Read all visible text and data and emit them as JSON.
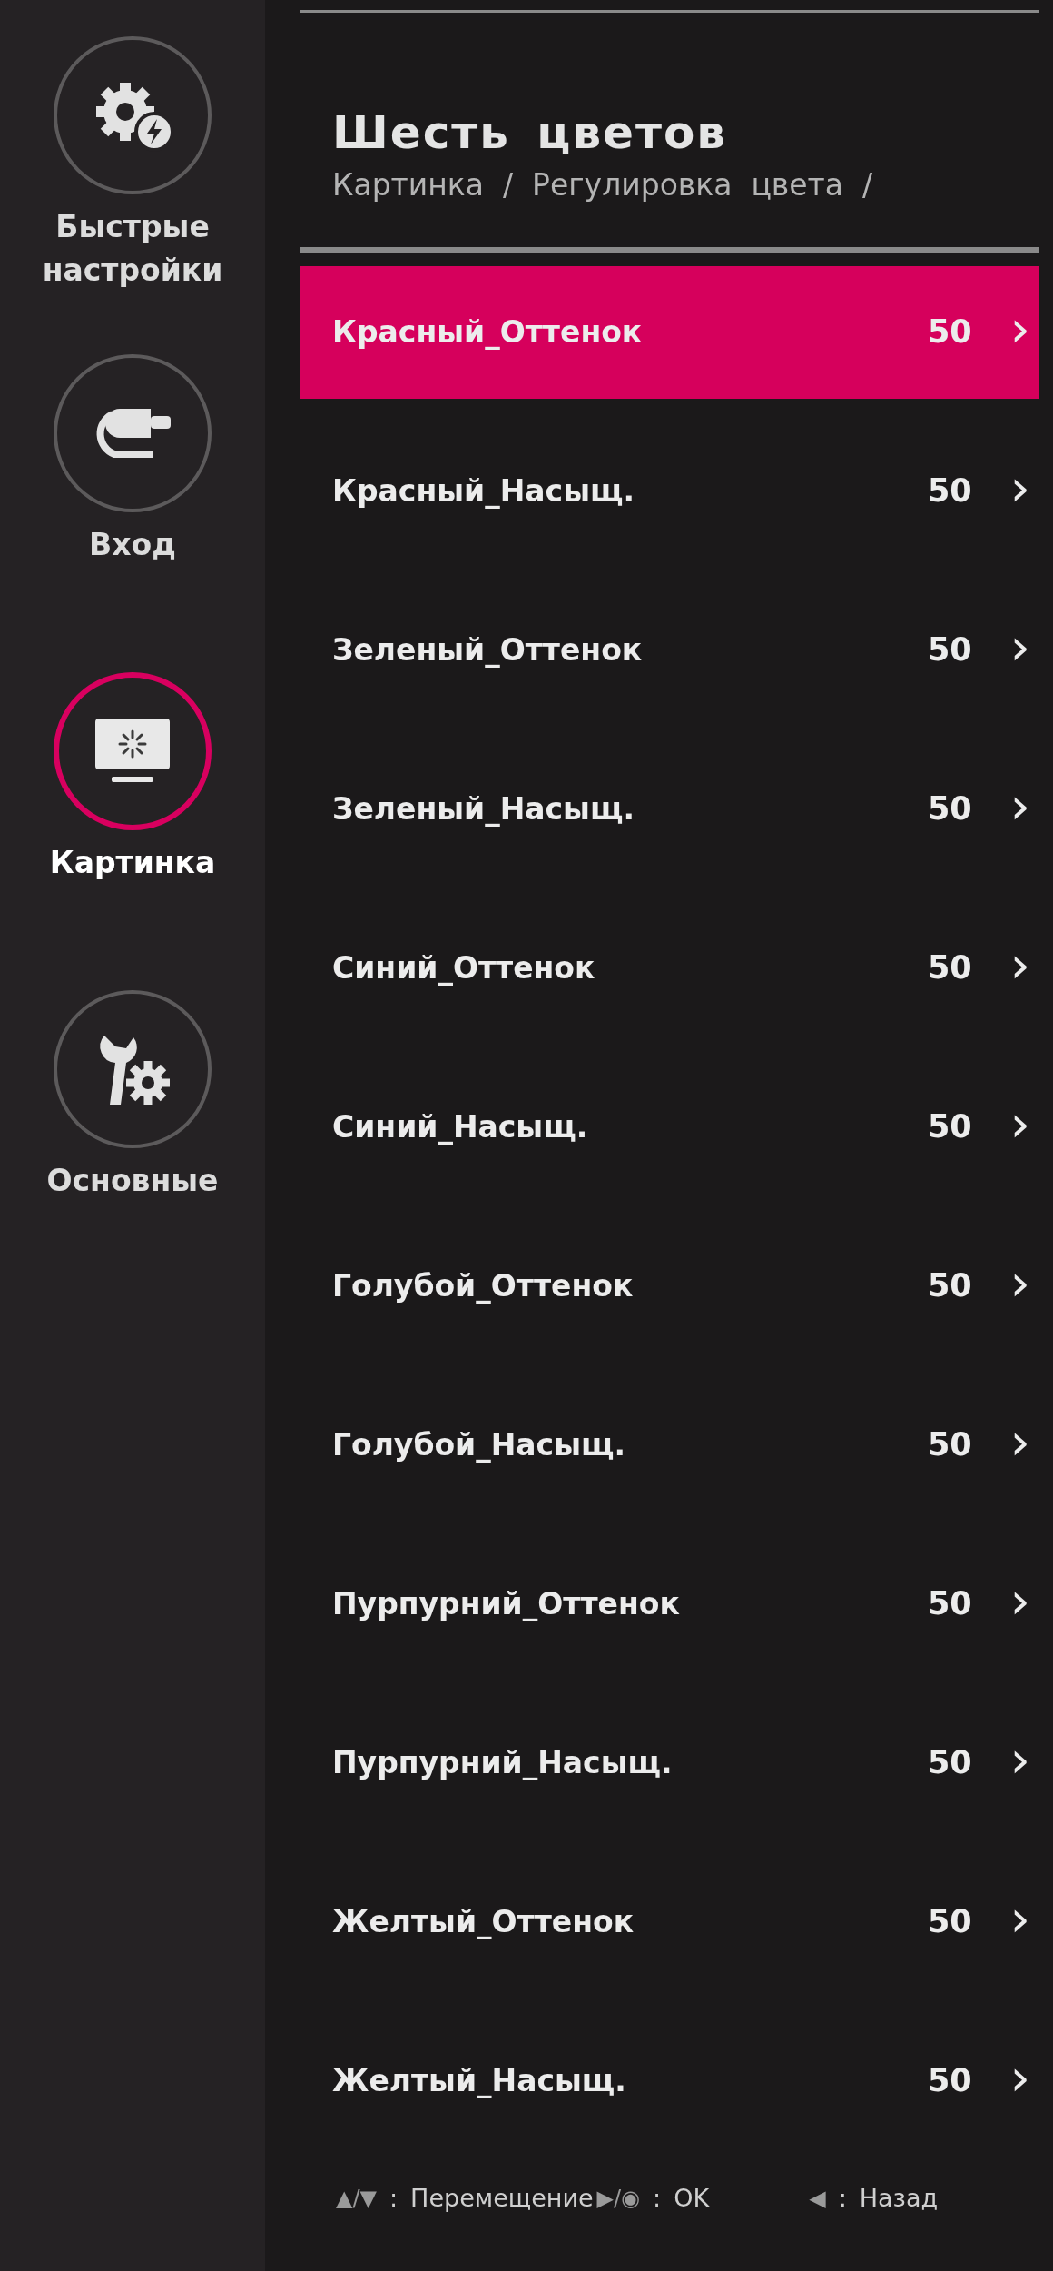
{
  "sidebar": {
    "items": [
      {
        "label": "Быстрые настройки",
        "selected": false
      },
      {
        "label": "Вход",
        "selected": false
      },
      {
        "label": "Картинка",
        "selected": true
      },
      {
        "label": "Основные",
        "selected": false
      }
    ]
  },
  "title": "Шесть цветов",
  "breadcrumb": "Картинка  /  Регулировка  цвета  /",
  "rows": [
    {
      "label": "Красный_Оттенок",
      "value": "50",
      "chevron": "›",
      "selected": true
    },
    {
      "label": "Красный_Насыщ.",
      "value": "50",
      "chevron": "›",
      "selected": false
    },
    {
      "label": "Зеленый_Оттенок",
      "value": "50",
      "chevron": "›",
      "selected": false
    },
    {
      "label": "Зеленый_Насыщ.",
      "value": "50",
      "chevron": "›",
      "selected": false
    },
    {
      "label": "Синий_Оттенок",
      "value": "50",
      "chevron": "›",
      "selected": false
    },
    {
      "label": "Синий_Насыщ.",
      "value": "50",
      "chevron": "›",
      "selected": false
    },
    {
      "label": "Голубой_Оттенок",
      "value": "50",
      "chevron": "›",
      "selected": false
    },
    {
      "label": "Голубой_Насыщ.",
      "value": "50",
      "chevron": "›",
      "selected": false
    },
    {
      "label": "Пурпурний_Оттенок",
      "value": "50",
      "chevron": "›",
      "selected": false
    },
    {
      "label": "Пурпурний_Насыщ.",
      "value": "50",
      "chevron": "›",
      "selected": false
    },
    {
      "label": "Желтый_Оттенок",
      "value": "50",
      "chevron": "›",
      "selected": false
    },
    {
      "label": "Желтый_Насыщ.",
      "value": "50",
      "chevron": "›",
      "selected": false
    }
  ],
  "footer": [
    {
      "keys": "▲/▼",
      "sep": ":",
      "label": "Перемещение"
    },
    {
      "keys": "▶/◉",
      "sep": ":",
      "label": "OK"
    },
    {
      "keys": "◀",
      "sep": ":",
      "label": "Назад"
    }
  ]
}
